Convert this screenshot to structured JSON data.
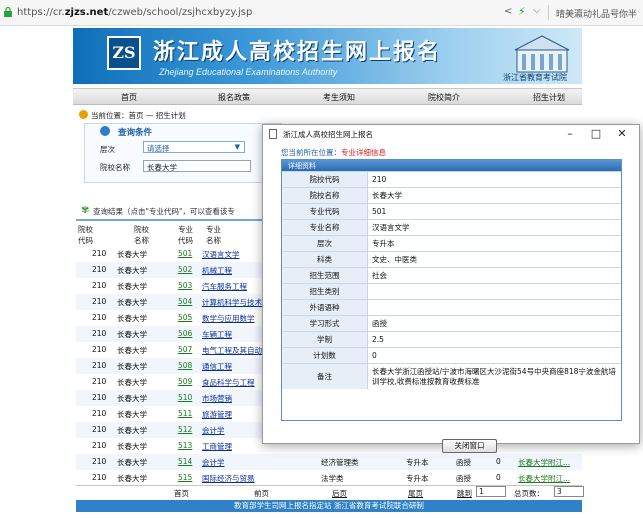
{
  "browser": {
    "url_prefix": "https://cr.",
    "url_domain": "zjzs.net",
    "url_path": "/czweb/school/zsjhcxbyzy.jsp",
    "extra_text": "晴美瀛动礼品号你半"
  },
  "banner": {
    "logo_text": "ZS",
    "title": "浙江成人高校招生网上报名",
    "subtitle": "Zhejiang Educational Examinations Authority",
    "org": "浙江省教育考试院"
  },
  "nav": [
    "首页",
    "报名政策",
    "考生须知",
    "院校简介",
    "招生计划"
  ],
  "breadcrumb": "当前位置：首页 — 招生计划",
  "search": {
    "title": "查询条件",
    "level_label": "层次",
    "level_value": "请选择",
    "school_label": "院校名称",
    "school_value": "长春大学"
  },
  "result_note": "查询结果（点击\"专业代码\"，可以查看该专",
  "table": {
    "headers": [
      {
        "l1": "院校",
        "l2": "代码"
      },
      {
        "l1": "院校",
        "l2": "名称"
      },
      {
        "l1": "专业",
        "l2": "代码"
      },
      {
        "l1": "专业",
        "l2": "名称"
      }
    ],
    "rows": [
      {
        "code": "210",
        "school": "长春大学",
        "major_code": "501",
        "major": "汉语言文学",
        "cat": "",
        "level": "",
        "form": "",
        "num": "",
        "link": ""
      },
      {
        "code": "210",
        "school": "长春大学",
        "major_code": "502",
        "major": "机械工程",
        "cat": "",
        "level": "",
        "form": "",
        "num": "",
        "link": ""
      },
      {
        "code": "210",
        "school": "长春大学",
        "major_code": "503",
        "major": "汽车服务工程",
        "cat": "",
        "level": "",
        "form": "",
        "num": "",
        "link": ""
      },
      {
        "code": "210",
        "school": "长春大学",
        "major_code": "504",
        "major": "计算机科学与技术",
        "cat": "",
        "level": "",
        "form": "",
        "num": "",
        "link": ""
      },
      {
        "code": "210",
        "school": "长春大学",
        "major_code": "505",
        "major": "数学与应用数学",
        "cat": "",
        "level": "",
        "form": "",
        "num": "",
        "link": ""
      },
      {
        "code": "210",
        "school": "长春大学",
        "major_code": "506",
        "major": "车辆工程",
        "cat": "",
        "level": "",
        "form": "",
        "num": "",
        "link": ""
      },
      {
        "code": "210",
        "school": "长春大学",
        "major_code": "507",
        "major": "电气工程及其自动化",
        "cat": "",
        "level": "",
        "form": "",
        "num": "",
        "link": ""
      },
      {
        "code": "210",
        "school": "长春大学",
        "major_code": "508",
        "major": "通信工程",
        "cat": "",
        "level": "",
        "form": "",
        "num": "",
        "link": ""
      },
      {
        "code": "210",
        "school": "长春大学",
        "major_code": "509",
        "major": "食品科学与工程",
        "cat": "",
        "level": "",
        "form": "",
        "num": "",
        "link": ""
      },
      {
        "code": "210",
        "school": "长春大学",
        "major_code": "510",
        "major": "市场营销",
        "cat": "",
        "level": "",
        "form": "",
        "num": "",
        "link": ""
      },
      {
        "code": "210",
        "school": "长春大学",
        "major_code": "511",
        "major": "旅游管理",
        "cat": "",
        "level": "",
        "form": "",
        "num": "",
        "link": ""
      },
      {
        "code": "210",
        "school": "长春大学",
        "major_code": "512",
        "major": "会计学",
        "cat": "",
        "level": "",
        "form": "",
        "num": "",
        "link": ""
      },
      {
        "code": "210",
        "school": "长春大学",
        "major_code": "513",
        "major": "工商管理",
        "cat": "",
        "level": "",
        "form": "",
        "num": "",
        "link": ""
      },
      {
        "code": "210",
        "school": "长春大学",
        "major_code": "514",
        "major": "会计学",
        "cat": "经济管理类",
        "level": "专升本",
        "form": "函授",
        "num": "0",
        "link": "长春大学附江..."
      },
      {
        "code": "210",
        "school": "长春大学",
        "major_code": "515",
        "major": "国际经济与贸易",
        "cat": "法学类",
        "level": "专升本",
        "form": "函授",
        "num": "0",
        "link": "长春大学附江..."
      }
    ]
  },
  "pager": {
    "first": "首页",
    "prev": "前页",
    "next": "后页",
    "last": "尾页",
    "goto_label": "跳到",
    "goto_value": "1",
    "total_label": "总页数：",
    "total_value": "3"
  },
  "footer": "教育部学生司网上报名指定站  浙江省教育考试院联合研制",
  "dialog": {
    "title": "浙江成人高校招生网上报名",
    "loc_label": "您当前所在位置：",
    "loc_value": "专业详细信息",
    "section_header": "详细资料",
    "fields": [
      {
        "label": "院校代码",
        "value": "210"
      },
      {
        "label": "院校名称",
        "value": "长春大学"
      },
      {
        "label": "专业代码",
        "value": "501"
      },
      {
        "label": "专业名称",
        "value": "汉语言文学"
      },
      {
        "label": "层次",
        "value": "专升本"
      },
      {
        "label": "科类",
        "value": "文史、中医类"
      },
      {
        "label": "招生范围",
        "value": "社会"
      },
      {
        "label": "招生类别",
        "value": ""
      },
      {
        "label": "外语语种",
        "value": ""
      },
      {
        "label": "学习形式",
        "value": "函授"
      },
      {
        "label": "学制",
        "value": "2.5"
      },
      {
        "label": "计划数",
        "value": "0"
      },
      {
        "label": "备注",
        "value": "长春大学浙江函授站/宁波市海曙区大沙泥街54号中央商座818宁波金航培训学校,收费标准按教育收费标准"
      }
    ],
    "close_label": "关闭窗口"
  }
}
